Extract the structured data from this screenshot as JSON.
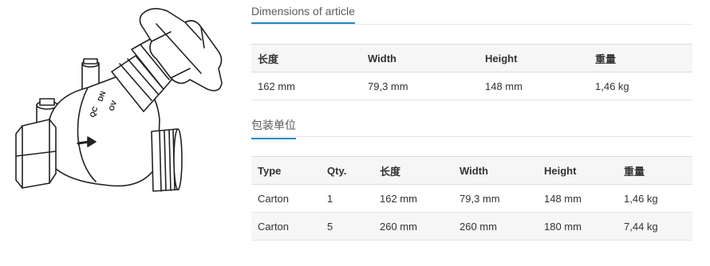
{
  "dimensions": {
    "title": "Dimensions of article",
    "headers": [
      "长度",
      "Width",
      "Height",
      "重量"
    ],
    "row": [
      "162 mm",
      "79,3 mm",
      "148 mm",
      "1,46 kg"
    ]
  },
  "packaging": {
    "title": "包装单位",
    "headers": [
      "Type",
      "Qty.",
      "长度",
      "Width",
      "Height",
      "重量"
    ],
    "rows": [
      [
        "Carton",
        "1",
        "162 mm",
        "79,3 mm",
        "148 mm",
        "1,46 kg"
      ],
      [
        "Carton",
        "5",
        "260 mm",
        "260 mm",
        "180 mm",
        "7,44 kg"
      ]
    ]
  },
  "product_image": {
    "engraving_line1": "DN",
    "engraving_line2": "QC",
    "engraving_line3": "OV"
  },
  "colors": {
    "accent": "#1e8ac4",
    "header_bg": "#f6f6f6"
  }
}
